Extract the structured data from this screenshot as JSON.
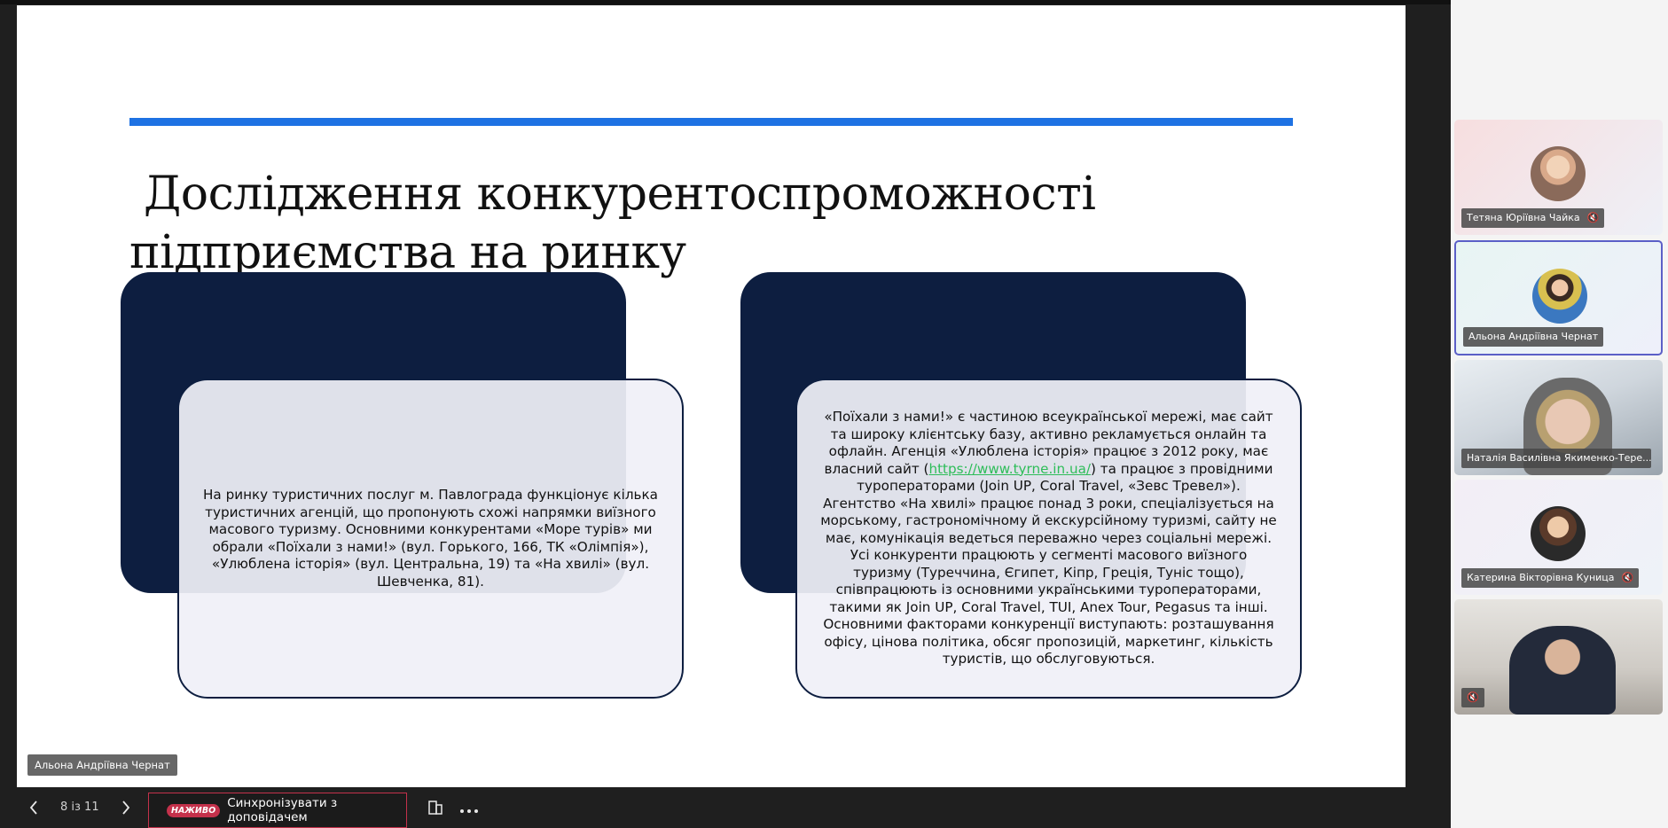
{
  "slide": {
    "title_line1": " Дослідження конкурентоспроможності",
    "title_line2": "підприємства на ринку",
    "card1_text": "На ринку туристичних послуг м. Павлограда функціонує кілька туристичних агенцій, що пропонують схожі напрямки виїзного масового туризму. Основними конкурентами  «Море турів» ми обрали «Поїхали з нами!» (вул. Горького, 166, ТК «Олімпія»), «Улюблена історія» (вул. Центральна, 19) та «На хвилі» (вул. Шевченка, 81).",
    "card2_text_before": "«Поїхали з нами!» є частиною всеукраїнської мережі, має сайт та широку клієнтську базу, активно рекламується онлайн та офлайн. Агенція «Улюблена історія» працює з 2012 року, має власний сайт (",
    "card2_link": "https://www.tyrne.in.ua/",
    "card2_text_after": ") та працює з провідними туроператорами (Join UP, Coral Travel, «Зевс Тревел»). Агентство «На хвилі» працює понад 3 роки, спеціалізується на морському, гастрономічному й екскурсійному туризмі, сайту не має, комунікація ведеться переважно через соціальні мережі. Усі конкуренти працюють у сегменті масового виїзного туризму (Туреччина, Єгипет, Кіпр, Греція, Туніс тощо), співпрацюють із основними українськими туроператорами, такими як Join UP, Coral Travel, TUI, Anex Tour, Pegasus та інші. Основними факторами конкуренції виступають: розташування офісу, цінова політика, обсяг пропозицій, маркетинг, кількість туристів, що обслуговуються."
  },
  "presenter_name": "Альона Андріївна Чернат",
  "controls": {
    "page_counter": "8 із 11",
    "live_label": "НАЖИВО",
    "sync_label": "Синхронізувати з доповідачем"
  },
  "participants": [
    {
      "name": "Тетяна Юріївна Чайка",
      "muted": true
    },
    {
      "name": "Альона Андріївна Чернат",
      "muted": false,
      "active": true
    },
    {
      "name": "Наталія Василівна Якименко-Тере...",
      "muted": false
    },
    {
      "name": "Катерина Вікторівна Куница",
      "muted": true
    },
    {
      "name": "",
      "muted": true
    }
  ],
  "colors": {
    "accent_blue": "#1e72e3",
    "card_dark": "#0d1e40",
    "live_red": "#c4314b",
    "active_border": "#5b5fc7",
    "link_green": "#2ebd59"
  }
}
